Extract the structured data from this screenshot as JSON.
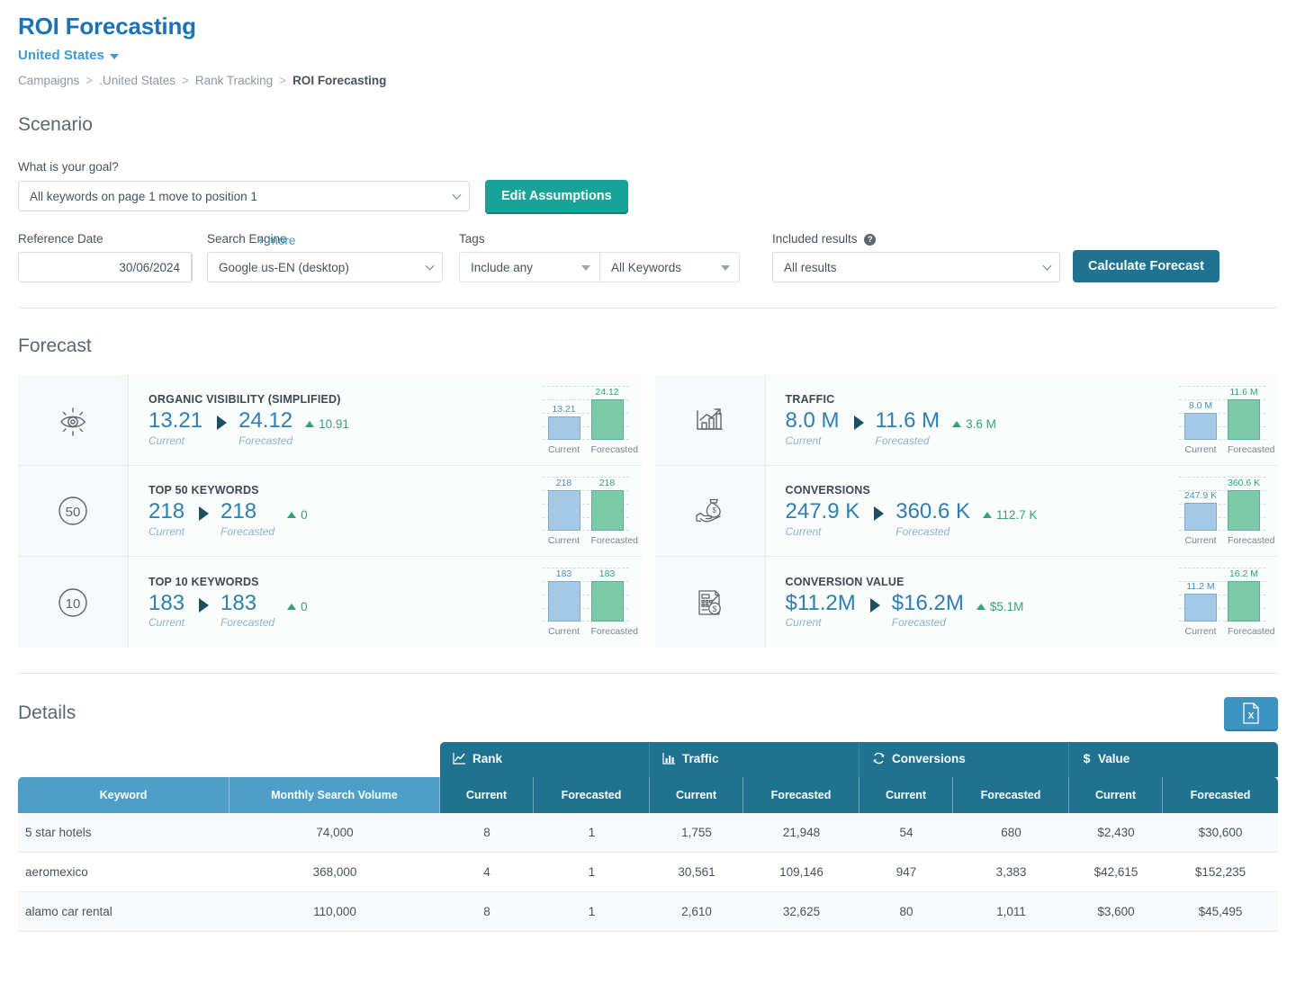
{
  "header": {
    "title": "ROI Forecasting",
    "country": "United States",
    "country_caret": "caret-down-icon",
    "breadcrumb": [
      "Campaigns",
      ".United States",
      "Rank Tracking",
      "ROI Forecasting"
    ],
    "breadcrumb_sep": ">"
  },
  "scenario": {
    "heading": "Scenario",
    "goal_label": "What is your goal?",
    "goal_value": "All keywords on page 1 move to position 1",
    "edit_assumptions": "Edit Assumptions",
    "reference_date_label": "Reference Date",
    "reference_date_value": "30/06/2024",
    "calendar_icon": "calendar-icon",
    "search_engine_label": "Search Engine",
    "search_engine_value": "Google us-EN (desktop)",
    "tags_label": "Tags",
    "tags_mode": "Include any",
    "tags_value": "All Keywords",
    "more_link": "+ more",
    "included_results_label": "Included results",
    "included_results_help": "?",
    "included_results_value": "All results",
    "calculate_button": "Calculate Forecast"
  },
  "forecast": {
    "heading": "Forecast",
    "axis_current": "Current",
    "axis_forecasted": "Forecasted",
    "cards": [
      {
        "icon": "eye-icon",
        "title": "ORGANIC VISIBILITY (SIMPLIFIED)",
        "current": "13.21",
        "forecasted": "24.12",
        "delta": "10.91",
        "current_caption": "Current",
        "forecasted_caption": "Forecasted",
        "chart": {
          "current_label": "13.21",
          "forecasted_label": "24.12",
          "current_h": 26,
          "forecasted_h": 45
        }
      },
      {
        "icon": "circle-50-icon",
        "title": "TOP 50 KEYWORDS",
        "current": "218",
        "forecasted": "218",
        "delta": "0",
        "current_caption": "Current",
        "forecasted_caption": "Forecasted",
        "chart": {
          "current_label": "218",
          "forecasted_label": "218",
          "current_h": 45,
          "forecasted_h": 45
        }
      },
      {
        "icon": "circle-10-icon",
        "title": "TOP 10 KEYWORDS",
        "current": "183",
        "forecasted": "183",
        "delta": "0",
        "current_caption": "Current",
        "forecasted_caption": "Forecasted",
        "chart": {
          "current_label": "183",
          "forecasted_label": "183",
          "current_h": 45,
          "forecasted_h": 45
        }
      },
      {
        "icon": "bar-chart-up-icon",
        "title": "TRAFFIC",
        "current": "8.0 M",
        "forecasted": "11.6 M",
        "delta": "3.6 M",
        "current_caption": "Current",
        "forecasted_caption": "Forecasted",
        "chart": {
          "current_label": "8.0 M",
          "forecasted_label": "11.6 M",
          "current_h": 30,
          "forecasted_h": 45
        }
      },
      {
        "icon": "money-bag-hand-icon",
        "title": "CONVERSIONS",
        "current": "247.9 K",
        "forecasted": "360.6 K",
        "delta": "112.7 K",
        "current_caption": "Current",
        "forecasted_caption": "Forecasted",
        "chart": {
          "current_label": "247.9 K",
          "forecasted_label": "360.6 K",
          "current_h": 31,
          "forecasted_h": 45
        }
      },
      {
        "icon": "invoice-dollar-icon",
        "title": "CONVERSION VALUE",
        "current": "$11.2M",
        "forecasted": "$16.2M",
        "delta": "$5.1M",
        "current_caption": "Current",
        "forecasted_caption": "Forecasted",
        "chart": {
          "current_label": "11.2 M",
          "forecasted_label": "16.2 M",
          "current_h": 31,
          "forecasted_h": 45
        }
      }
    ]
  },
  "details": {
    "heading": "Details",
    "export_icon": "excel-export-icon",
    "groups": [
      {
        "label": "Rank",
        "icon": "line-chart-icon"
      },
      {
        "label": "Traffic",
        "icon": "bar-chart-icon"
      },
      {
        "label": "Conversions",
        "icon": "refresh-icon"
      },
      {
        "label": "Value",
        "icon": "dollar-icon"
      }
    ],
    "columns": [
      "Keyword",
      "Monthly Search Volume",
      "Current",
      "Forecasted",
      "Current",
      "Forecasted",
      "Current",
      "Forecasted",
      "Current",
      "Forecasted"
    ],
    "rows": [
      [
        "5 star hotels",
        "74,000",
        "8",
        "1",
        "1,755",
        "21,948",
        "54",
        "680",
        "$2,430",
        "$30,600"
      ],
      [
        "aeromexico",
        "368,000",
        "4",
        "1",
        "30,561",
        "109,146",
        "947",
        "3,383",
        "$42,615",
        "$152,235"
      ],
      [
        "alamo car rental",
        "110,000",
        "8",
        "1",
        "2,610",
        "32,625",
        "80",
        "1,011",
        "$3,600",
        "$45,495"
      ]
    ]
  },
  "colors": {
    "brand_blue": "#1b72b8",
    "link_blue": "#3d9ad6",
    "teal": "#17a398",
    "dark_teal": "#1f7391",
    "bar_current": "#a5c9e4",
    "bar_forecast": "#7fc9ab",
    "delta_green": "#2fa37e"
  }
}
